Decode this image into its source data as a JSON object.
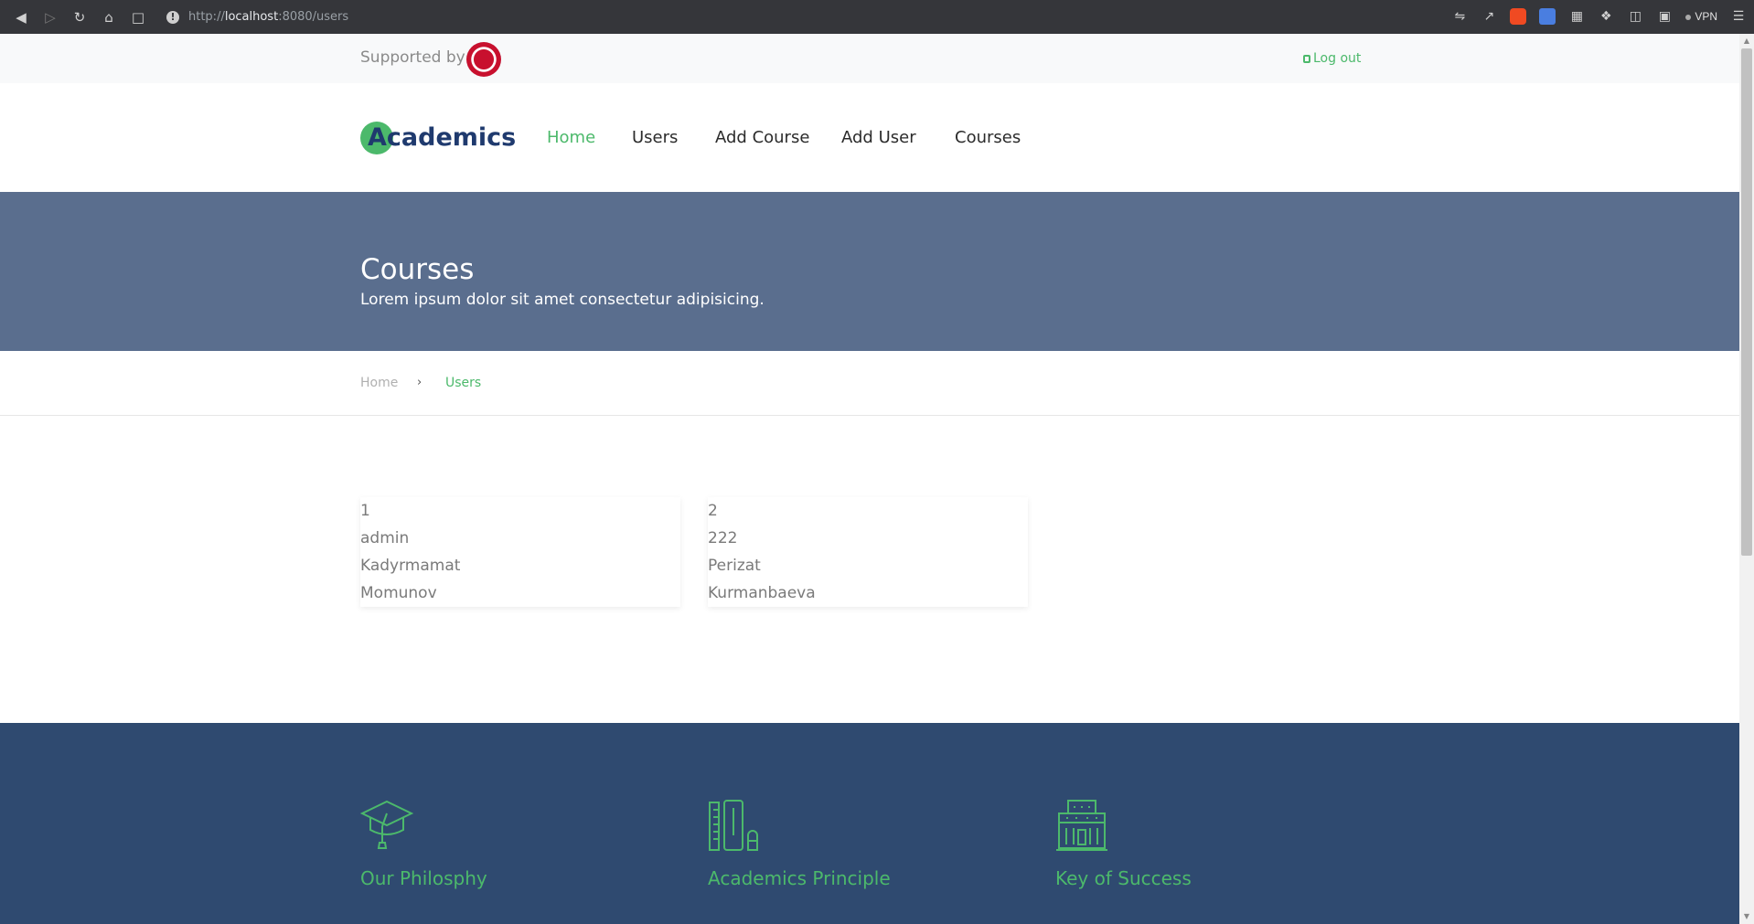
{
  "browser": {
    "url_prefix": "http://",
    "url_host": "localhost",
    "url_rest": ":8080/users",
    "vpn_label": "VPN"
  },
  "topbar": {
    "supported_label": "Supported by",
    "logout_label": "Log out"
  },
  "nav": {
    "logo": "Academics",
    "items": [
      {
        "label": "Home",
        "active": true
      },
      {
        "label": "Users"
      },
      {
        "label": "Add Course"
      },
      {
        "label": "Add User"
      },
      {
        "label": "Courses"
      }
    ]
  },
  "hero": {
    "title": "Courses",
    "subtitle": "Lorem ipsum dolor sit amet consectetur adipisicing."
  },
  "breadcrumb": {
    "home": "Home",
    "separator": "›",
    "current": "Users"
  },
  "users": [
    {
      "id": "1",
      "username": "admin",
      "first_name": "Kadyrmamat",
      "last_name": "Momunov"
    },
    {
      "id": "2",
      "username": "222",
      "first_name": "Perizat",
      "last_name": "Kurmanbaeva"
    }
  ],
  "features": [
    {
      "title": "Our Philosphy",
      "icon": "graduation-cap-icon"
    },
    {
      "title": "Academics Principle",
      "icon": "ruler-pencil-icon"
    },
    {
      "title": "Key of Success",
      "icon": "school-building-icon"
    }
  ],
  "colors": {
    "accent": "#4cb96b",
    "brand": "#1f3a6e",
    "hero": "#5a6e8e",
    "footer": "#2f4a70"
  }
}
